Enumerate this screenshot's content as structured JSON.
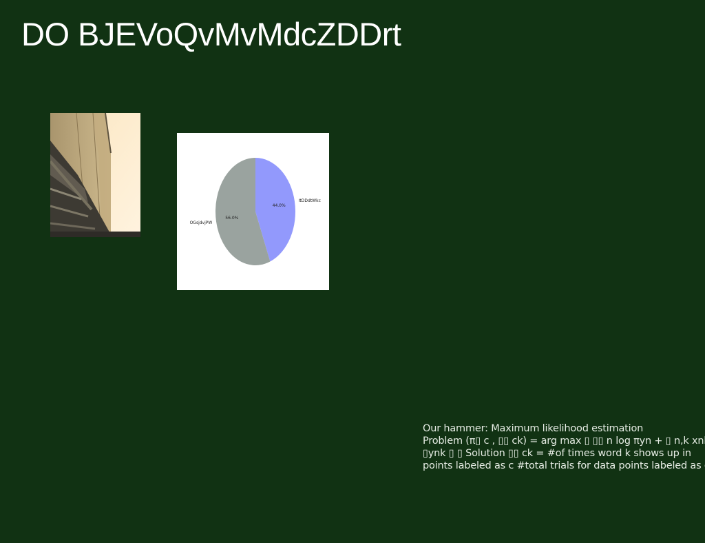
{
  "slide": {
    "title": "DO BJEVoQvMvMdcZDDrt",
    "background_color": "#113213"
  },
  "photo": {
    "icon": "building-facade-photo"
  },
  "chart_data": {
    "type": "pie",
    "labels": [
      "ItDDdtWkc",
      "OGsjdvjPW"
    ],
    "values": [
      44.0,
      56.0
    ],
    "value_labels": [
      "44.0%",
      "56.0%"
    ],
    "colors": [
      "#9299fc",
      "#9aa39f"
    ]
  },
  "text_block": {
    "lines": [
      "Our hammer: Maximum likelihood estimation",
      "Problem (π▯ c , ▯▯ ck) = arg max ▯ ▯▯ n log πyn + ▯ n,k xnk",
      "▯ynk ▯ ▯ Solution ▯▯ ck = #of times word k shows up in",
      "points labeled as c #total trials for data points labeled as c"
    ]
  }
}
